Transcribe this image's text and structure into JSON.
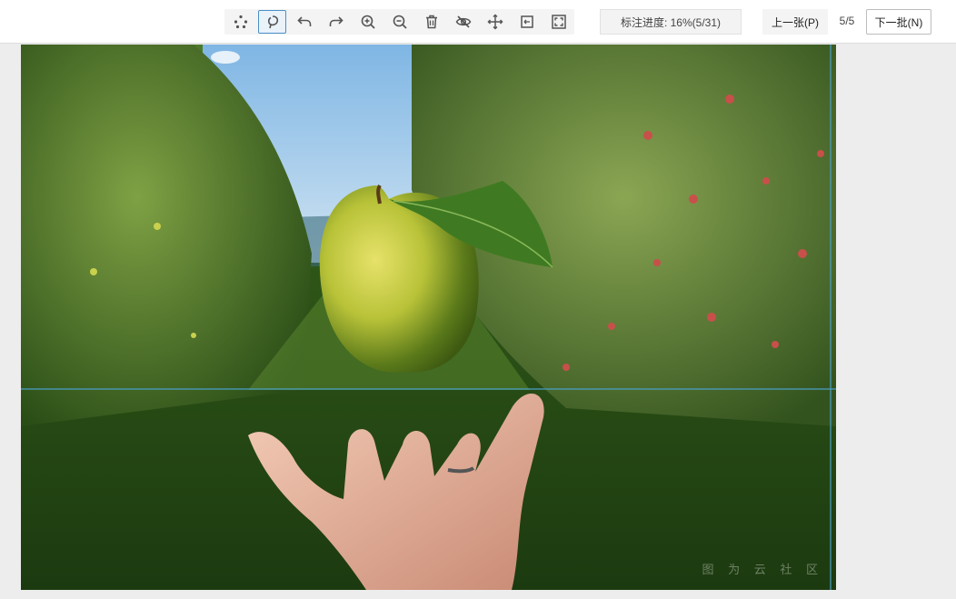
{
  "toolbar": {
    "tools": [
      {
        "name": "keypoints-tool",
        "icon": "keypoints-icon",
        "active": false
      },
      {
        "name": "polygon-tool",
        "icon": "lasso-icon",
        "active": true
      },
      {
        "name": "undo-tool",
        "icon": "undo-icon",
        "active": false
      },
      {
        "name": "redo-tool",
        "icon": "redo-icon",
        "active": false
      },
      {
        "name": "zoom-in-tool",
        "icon": "zoom-in-icon",
        "active": false
      },
      {
        "name": "zoom-out-tool",
        "icon": "zoom-out-icon",
        "active": false
      },
      {
        "name": "delete-tool",
        "icon": "trash-icon",
        "active": false
      },
      {
        "name": "hide-tool",
        "icon": "eye-off-icon",
        "active": false
      },
      {
        "name": "move-tool",
        "icon": "move-icon",
        "active": false
      },
      {
        "name": "fit-tool",
        "icon": "fit-icon",
        "active": false
      },
      {
        "name": "fullscreen-tool",
        "icon": "fullscreen-icon",
        "active": false
      }
    ]
  },
  "progress": {
    "text": "标注进度: 16%(5/31)"
  },
  "nav": {
    "prev_label": "上一张(P)",
    "page_indicator": "5/5",
    "next_label": "下一批(N)"
  },
  "watermark": {
    "text": "图 为 云 社 区"
  },
  "colors": {
    "accent": "#4a90c8",
    "guide_line": "#4aa0c8",
    "topbar_bg": "#ffffff",
    "page_bg": "#ededed"
  }
}
